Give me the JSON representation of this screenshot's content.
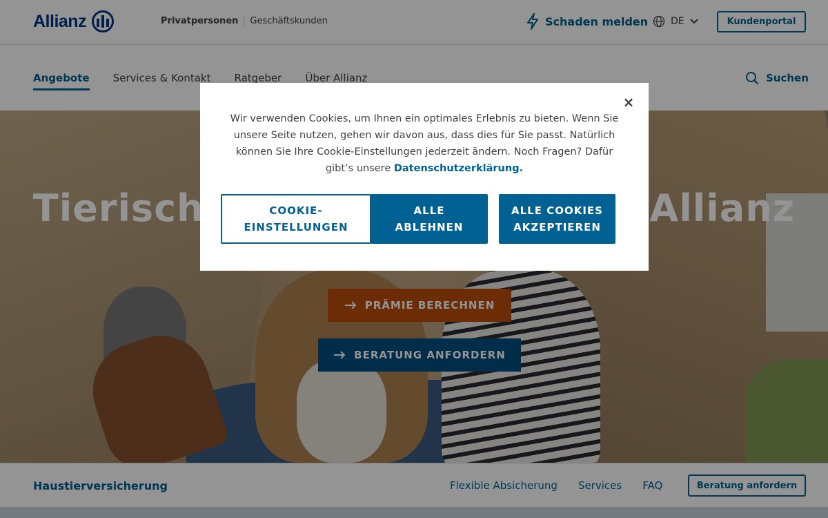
{
  "header": {
    "logo_text": "Allianz",
    "segment_private": "Privatpersonen",
    "segment_business": "Geschäftskunden",
    "schaden_label": "Schaden melden",
    "language": "DE",
    "portal_label": "Kundenportal"
  },
  "nav": {
    "items": [
      "Angebote",
      "Services & Kontakt",
      "Ratgeber",
      "Über Allianz"
    ],
    "search_label": "Suchen"
  },
  "hero": {
    "title": "Tierische Sicherheit mit der Allianz",
    "primary_cta": "PRÄMIE BERECHNEN",
    "secondary_cta": "BERATUNG ANFORDERN"
  },
  "productbar": {
    "name": "Haustierversicherung",
    "links": [
      "Flexible Absicherung",
      "Services",
      "FAQ"
    ],
    "cta": "Beratung anfordern"
  },
  "cookie_modal": {
    "text": "Wir verwenden Cookies, um Ihnen ein optimales Erlebnis zu bieten. Wenn Sie unsere Seite nutzen, gehen wir davon aus, dass dies für Sie passt. Natürlich können Sie Ihre Cookie-Einstellungen jederzeit ändern. Noch Fragen? Dafür gibt’s unsere",
    "link": "Datenschutzerklärung.",
    "settings_button": "COOKIE-EINSTELLUNGEN",
    "reject_button": "ALLE ABLEHNEN",
    "accept_button": "ALLE COOKIES AKZEPTIEREN",
    "close_symbol": "×"
  },
  "icons": {
    "bolt": "bolt-icon",
    "globe": "globe-icon",
    "chevron": "chevron-down-icon",
    "search": "search-icon",
    "arrow": "arrow-right-icon",
    "close": "close-icon"
  },
  "colors": {
    "brand_blue": "#003781",
    "accent_blue": "#006192",
    "cta_orange": "#b84d0c"
  }
}
